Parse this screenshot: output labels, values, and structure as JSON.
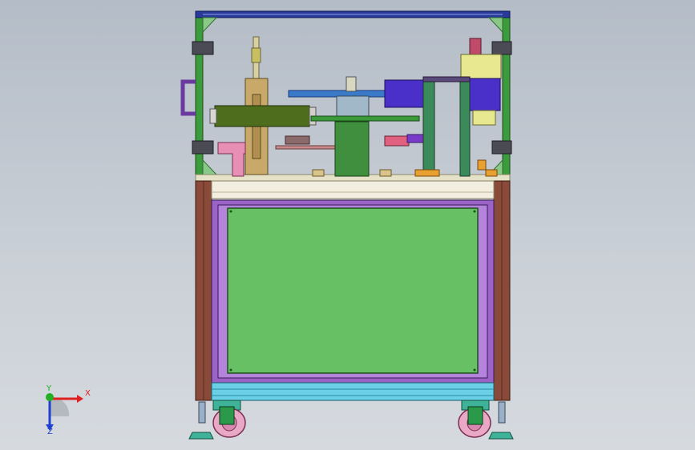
{
  "viewport": {
    "background_top": "#b4bcc7",
    "background_bottom": "#d6dadf"
  },
  "colors": {
    "frame_green": "#3c9b3c",
    "top_bar_blue": "#2a3a9a",
    "panel_green": "#67c064",
    "cabinet_purple": "#9b63c6",
    "post_brown": "#8a4a3a",
    "cylinder_olive": "#4e6e1e",
    "motor_blue": "#4a2fc8",
    "plate_tan": "#c9a96a",
    "wheel_pink": "#e8a8c6",
    "foot_teal": "#3fb39a"
  },
  "triad": {
    "x_label": "X",
    "y_label": "Y",
    "z_label": "Z",
    "x_color": "#e02020",
    "y_color": "#20b020",
    "z_color": "#2040d0"
  }
}
